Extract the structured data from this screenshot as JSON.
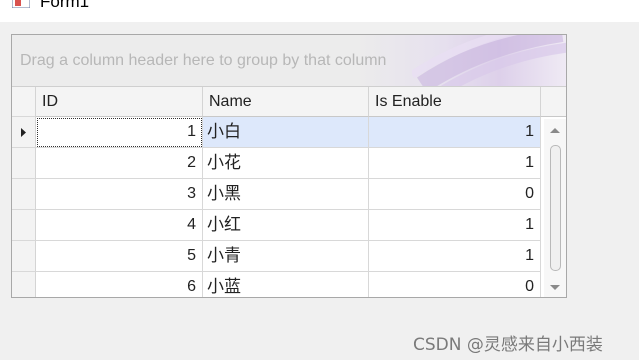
{
  "window": {
    "title": "Form1"
  },
  "grid": {
    "group_panel_text": "Drag a column header here to group by that column",
    "columns": [
      "ID",
      "Name",
      "Is Enable"
    ],
    "rows": [
      {
        "id": "1",
        "name": "小白",
        "enable": "1"
      },
      {
        "id": "2",
        "name": "小花",
        "enable": "1"
      },
      {
        "id": "3",
        "name": "小黑",
        "enable": "0"
      },
      {
        "id": "4",
        "name": "小红",
        "enable": "1"
      },
      {
        "id": "5",
        "name": "小青",
        "enable": "1"
      },
      {
        "id": "6",
        "name": "小蓝",
        "enable": "0"
      }
    ],
    "selected_row": 1
  },
  "watermark": "CSDN @灵感来自小西装",
  "colors": {
    "selection": "#dde8fb",
    "border": "#a8a8a8"
  }
}
